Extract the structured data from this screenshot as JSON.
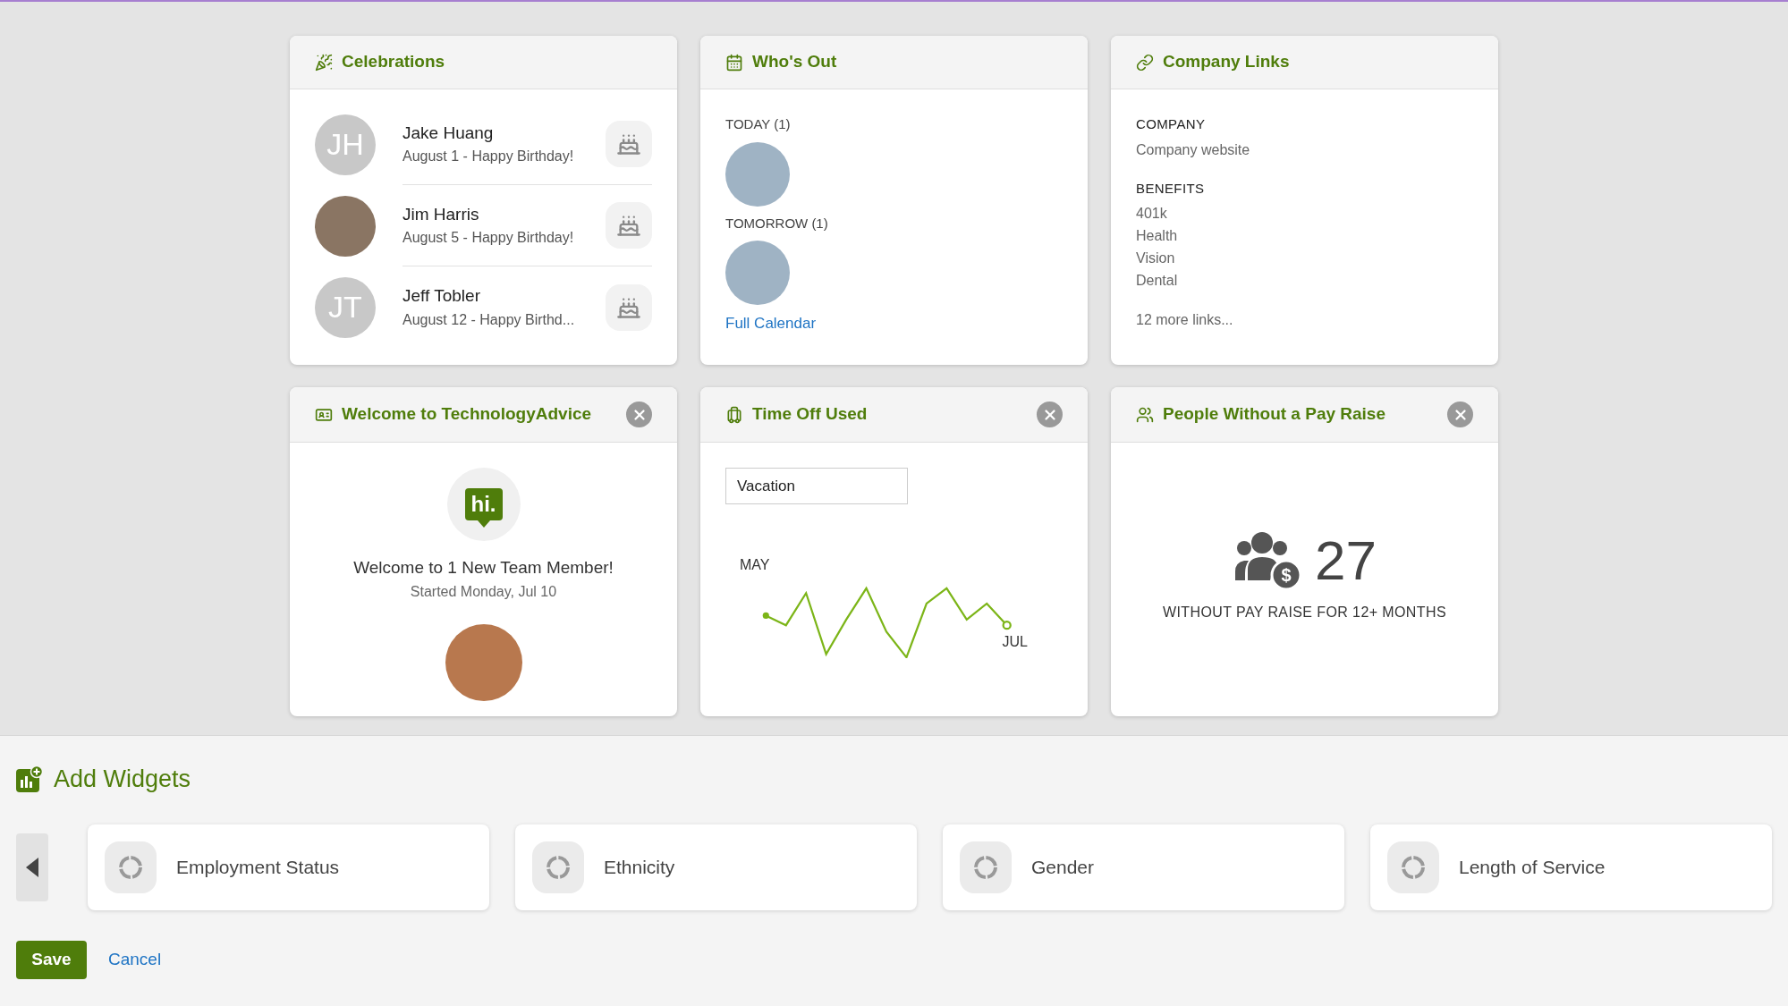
{
  "cards": [
    {
      "kind": "celebrations",
      "title": "Celebrations",
      "closable": false,
      "items": [
        {
          "name": "Jake Huang",
          "detail": "August 1 - Happy Birthday!",
          "avatar": {
            "kind": "initials",
            "text": "JH"
          }
        },
        {
          "name": "Jim Harris",
          "detail": "August 5 - Happy Birthday!",
          "avatar": {
            "kind": "photo"
          }
        },
        {
          "name": "Jeff Tobler",
          "detail": "August 12 - Happy Birthd...",
          "avatar": {
            "kind": "initials",
            "text": "JT"
          }
        }
      ]
    },
    {
      "kind": "whos_out",
      "title": "Who's Out",
      "closable": false,
      "groups": [
        {
          "label": "TODAY (1)"
        },
        {
          "label": "TOMORROW (1)"
        }
      ],
      "link": "Full Calendar"
    },
    {
      "kind": "links",
      "title": "Company Links",
      "closable": false,
      "sections": [
        {
          "heading": "COMPANY",
          "links": [
            "Company website"
          ]
        },
        {
          "heading": "BENEFITS",
          "links": [
            "401k",
            "Health",
            "Vision",
            "Dental"
          ]
        }
      ],
      "more": "12 more links..."
    },
    {
      "kind": "welcome",
      "title": "Welcome to TechnologyAdvice",
      "closable": true,
      "badge": "hi.",
      "heading": "Welcome to 1 New Team Member!",
      "subtext": "Started Monday, Jul 10"
    },
    {
      "kind": "time_off",
      "title": "Time Off Used",
      "closable": true,
      "select": {
        "value": "Vacation"
      },
      "chart": {
        "start_label": "MAY",
        "end_label": "JUL"
      }
    },
    {
      "kind": "pay_raise",
      "title": "People Without a Pay Raise",
      "closable": true,
      "count": "27",
      "currency_symbol": "$",
      "caption": "WITHOUT PAY RAISE FOR 12+ MONTHS"
    }
  ],
  "add_widgets": {
    "title": "Add Widgets",
    "items": [
      "Employment Status",
      "Ethnicity",
      "Gender",
      "Length of Service"
    ]
  },
  "actions": {
    "save": "Save",
    "cancel": "Cancel"
  }
}
